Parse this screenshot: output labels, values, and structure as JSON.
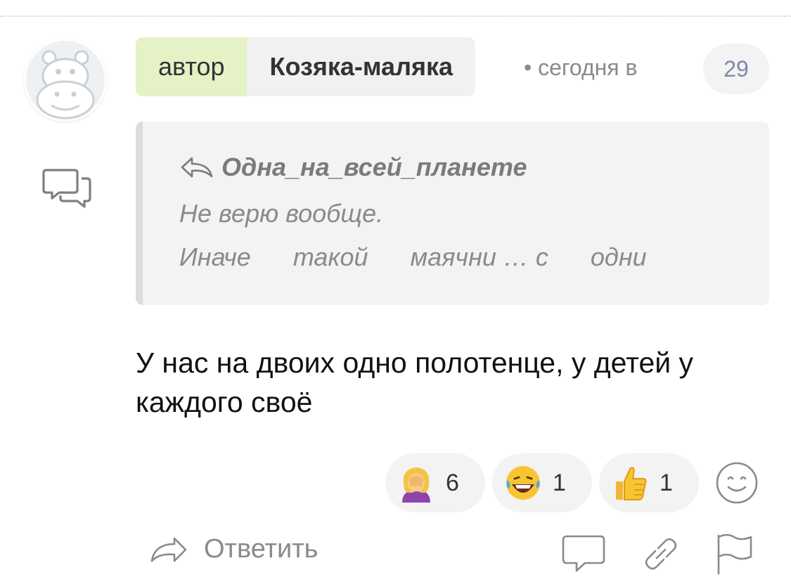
{
  "header": {
    "author_tag": "автор",
    "username": "Козяка-маляка",
    "meta": "• сегодня в",
    "count": "29"
  },
  "quote": {
    "author": "Одна_на_всей_планете",
    "line1": "Не верю вообще.",
    "line2": "Иначе      такой      маячни … с      одни"
  },
  "comment": {
    "text": "У нас на двоих одно полотенце, у детей у каждого своё"
  },
  "reactions": [
    {
      "icon": "facepalm-emoji",
      "count": "6"
    },
    {
      "icon": "laughing-tears-emoji",
      "count": "1"
    },
    {
      "icon": "thumbs-up-emoji",
      "count": "1"
    }
  ],
  "actions": {
    "reply_label": "Ответить"
  },
  "icons": {
    "avatar": "hippo-avatar",
    "thread": "chat-bubbles-icon",
    "add_reaction": "smiley-icon",
    "comment": "comment-icon",
    "link": "link-icon",
    "flag": "flag-icon"
  },
  "colors": {
    "author_tag_bg": "#e4f2c6",
    "pill_bg": "#f1f1f1",
    "quote_bg": "#f3f3f3",
    "count_color": "#7a8aa8",
    "muted_text": "#8a8a8a"
  }
}
